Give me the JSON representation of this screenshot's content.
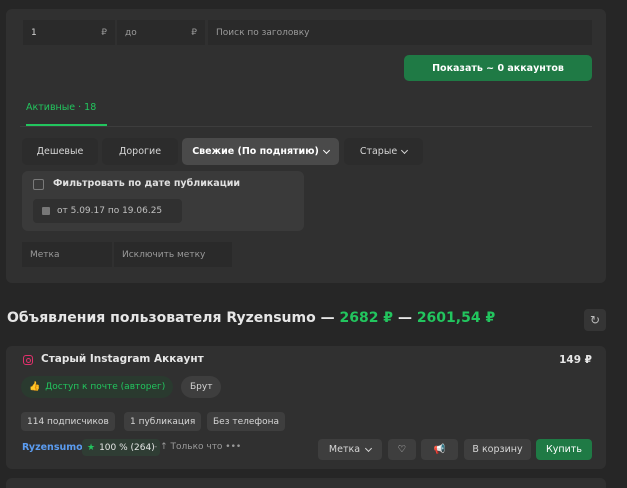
{
  "filters": {
    "price_from": "1",
    "currency_from": "₽",
    "price_to_placeholder": "до",
    "currency_to": "₽",
    "title_search_placeholder": "Поиск по заголовку",
    "show_button": "Показать ~ 0 аккаунтов",
    "tab_active": "Активные · 18",
    "sort_options": [
      "Дешевые",
      "Дорогие",
      "Свежие (По поднятию)",
      "Старые"
    ],
    "sort_active": "Свежие (По поднятию)",
    "publish_date_filter_label": "Фильтровать по дате публикации",
    "date_range": "от 5.09.17 по 19.06.25",
    "tag_placeholder": "Метка",
    "exclude_tag_placeholder": "Исключить метку"
  },
  "heading": {
    "prefix": "Объявления пользователя Ryzensumo —",
    "sum1": "2682 ₽",
    "dash": "—",
    "sum2": "2601,54 ₽"
  },
  "listing": {
    "title": "Старый Instagram Аккаунт",
    "price": "149 ₽",
    "mail_access_badge": "Доступ к почте (авторег)",
    "brute_badge": "Брут",
    "tags": [
      "114 подписчиков",
      "1 публикация",
      "Без телефона"
    ],
    "seller": "Ryzensumo",
    "rating": "100 % (264)",
    "meta": "- ↑ Только что  •••",
    "tag_button": "Метка",
    "cart_button": "В корзину",
    "buy_button": "Купить"
  },
  "colors": {
    "accent_green": "#22c55e",
    "button_green": "#1f7a45",
    "instagram": "#e1306c",
    "seller_link": "#5b9cf0"
  }
}
